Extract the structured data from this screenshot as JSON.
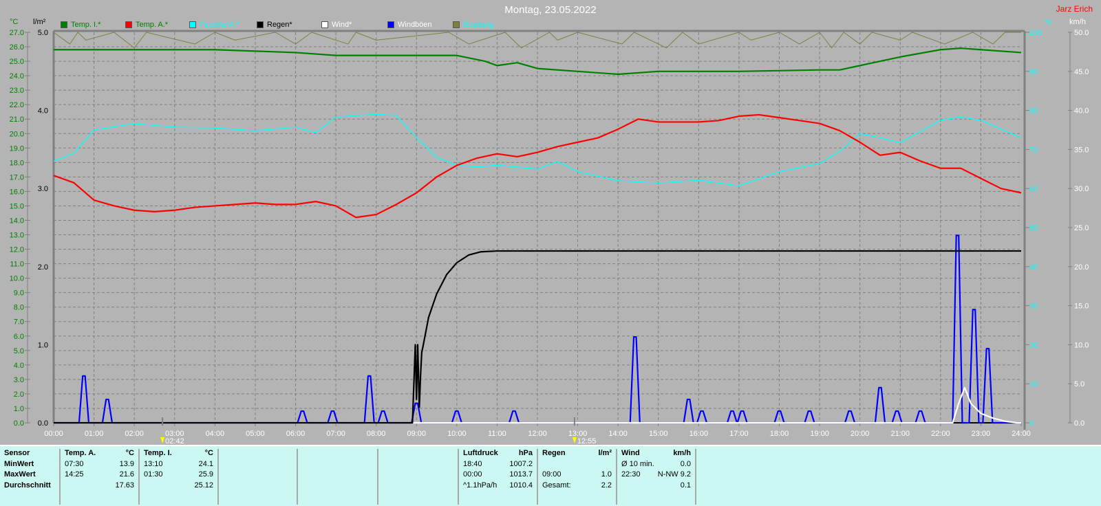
{
  "header": {
    "title": "Montag, 23.05.2022",
    "author": "Jarz Erich"
  },
  "units": {
    "left1": "°C",
    "left2": "l/m²",
    "right1": "%",
    "right2": "km/h"
  },
  "legend": [
    {
      "label": "Temp. I.*",
      "color": "#008000"
    },
    {
      "label": "Temp. A.*",
      "color": "#ff0000"
    },
    {
      "label": "Feuchte A.*",
      "color": "#00ffff"
    },
    {
      "label": "Regen*",
      "color": "#000000"
    },
    {
      "label": "Wind*",
      "color": "#ffffff"
    },
    {
      "label": "Windböen",
      "color": "#0000ff"
    },
    {
      "label": "Empfang",
      "color": "#808040"
    }
  ],
  "markers": [
    {
      "label": "02:42",
      "icon": "moon-icon",
      "t": 2.7
    },
    {
      "label": "12:55",
      "icon": "sun-icon",
      "t": 12.92
    }
  ],
  "chart_data": {
    "type": "line",
    "title": "Montag, 23.05.2022",
    "x_ticks": [
      "00:00",
      "01:00",
      "02:00",
      "03:00",
      "04:00",
      "05:00",
      "06:00",
      "07:00",
      "08:00",
      "09:00",
      "10:00",
      "11:00",
      "12:00",
      "13:00",
      "14:00",
      "15:00",
      "16:00",
      "17:00",
      "18:00",
      "19:00",
      "20:00",
      "21:00",
      "22:00",
      "23:00",
      "24:00"
    ],
    "xlim": [
      0,
      24
    ],
    "axes": {
      "temp": {
        "unit": "°C",
        "ylim": [
          0,
          27
        ],
        "step": 1
      },
      "rain": {
        "unit": "l/m²",
        "ylim": [
          0,
          5
        ],
        "step": 1
      },
      "humidity": {
        "unit": "%",
        "ylim": [
          0,
          100
        ],
        "step": 10
      },
      "wind": {
        "unit": "km/h",
        "ylim": [
          0,
          50
        ],
        "step": 5
      }
    },
    "series": [
      {
        "name": "Temp. I.*",
        "axis": "temp",
        "color": "#008000",
        "t": [
          0,
          2,
          4,
          6,
          7,
          9,
          10,
          10.7,
          11,
          11.5,
          12,
          13,
          14,
          15,
          17,
          19,
          19.5,
          20,
          21,
          22,
          22.5,
          23,
          24
        ],
        "v": [
          25.8,
          25.8,
          25.8,
          25.6,
          25.4,
          25.4,
          25.4,
          25.0,
          24.7,
          24.9,
          24.5,
          24.3,
          24.1,
          24.3,
          24.3,
          24.4,
          24.4,
          24.7,
          25.3,
          25.8,
          25.9,
          25.8,
          25.6
        ]
      },
      {
        "name": "Temp. A.*",
        "axis": "temp",
        "color": "#ff0000",
        "t": [
          0,
          0.5,
          1,
          1.5,
          2,
          2.5,
          3,
          3.5,
          4,
          4.5,
          5,
          5.5,
          6,
          6.5,
          7,
          7.5,
          8,
          8.5,
          9,
          9.5,
          10,
          10.5,
          11,
          11.5,
          12,
          12.5,
          13,
          13.5,
          14,
          14.5,
          15,
          15.5,
          16,
          16.5,
          17,
          17.5,
          18,
          18.5,
          19,
          19.5,
          20,
          20.5,
          21,
          21.5,
          22,
          22.5,
          23,
          23.5,
          24
        ],
        "v": [
          17.1,
          16.6,
          15.4,
          15.0,
          14.7,
          14.6,
          14.7,
          14.9,
          15.0,
          15.1,
          15.2,
          15.1,
          15.1,
          15.3,
          15.0,
          14.2,
          14.4,
          15.1,
          15.9,
          17.0,
          17.8,
          18.3,
          18.6,
          18.4,
          18.7,
          19.1,
          19.4,
          19.7,
          20.3,
          21.0,
          20.8,
          20.8,
          20.8,
          20.9,
          21.2,
          21.3,
          21.1,
          20.9,
          20.7,
          20.2,
          19.4,
          18.5,
          18.7,
          18.1,
          17.6,
          17.6,
          16.9,
          16.2,
          15.9
        ]
      },
      {
        "name": "Feuchte A.*",
        "axis": "humidity",
        "color": "#00ffff",
        "t": [
          0,
          0.5,
          1,
          2,
          3,
          4,
          5,
          6,
          6.5,
          7,
          8,
          8.5,
          9,
          9.5,
          10,
          10.5,
          11,
          12,
          12.5,
          13,
          14,
          15,
          16,
          17,
          18,
          19,
          19.5,
          20,
          20.5,
          21,
          22,
          22.5,
          23,
          24
        ],
        "v": [
          67,
          69,
          75,
          76.6,
          75.7,
          75.5,
          74.8,
          75.7,
          74.3,
          78.3,
          79,
          78.7,
          73,
          68,
          66,
          65.5,
          66,
          65,
          66.9,
          64.3,
          62,
          61.4,
          62.1,
          60.7,
          64.3,
          66.4,
          69.5,
          74,
          73,
          71.7,
          77.5,
          78.3,
          77.5,
          73
        ]
      },
      {
        "name": "Regen*",
        "axis": "rain",
        "color": "#000000",
        "t": [
          0,
          8.9,
          8.97,
          9.0,
          9.03,
          9.07,
          9.1,
          9.13,
          9.17,
          9.3,
          9.5,
          9.75,
          10,
          10.3,
          10.6,
          11,
          24
        ],
        "v": [
          0,
          0,
          1.0,
          0.3,
          1.0,
          0.2,
          0.6,
          0.9,
          1.0,
          1.35,
          1.65,
          1.9,
          2.05,
          2.15,
          2.19,
          2.2,
          2.2
        ]
      },
      {
        "name": "Windböen",
        "axis": "wind",
        "color": "#0000ff",
        "peaks": [
          [
            0.75,
            6.0
          ],
          [
            1.33,
            3.0
          ],
          [
            6.17,
            1.5
          ],
          [
            6.92,
            1.5
          ],
          [
            7.83,
            6.0
          ],
          [
            8.17,
            1.5
          ],
          [
            9.0,
            2.5
          ],
          [
            10.0,
            1.5
          ],
          [
            11.42,
            1.5
          ],
          [
            14.42,
            11.0
          ],
          [
            15.75,
            3.0
          ],
          [
            16.08,
            1.5
          ],
          [
            16.83,
            1.5
          ],
          [
            17.08,
            1.5
          ],
          [
            18.0,
            1.5
          ],
          [
            18.75,
            1.5
          ],
          [
            19.75,
            1.5
          ],
          [
            20.5,
            4.5
          ],
          [
            20.92,
            1.5
          ],
          [
            21.5,
            1.5
          ],
          [
            22.42,
            24.0
          ],
          [
            22.83,
            14.5
          ],
          [
            23.17,
            9.5
          ]
        ]
      },
      {
        "name": "Wind*",
        "axis": "wind",
        "color": "#ffffff",
        "t": [
          0,
          22.3,
          22.45,
          22.6,
          22.75,
          23.0,
          23.3,
          23.6,
          23.9,
          24
        ],
        "v": [
          0,
          0,
          2.5,
          4.5,
          2.5,
          1.2,
          0.6,
          0.2,
          0,
          0
        ]
      },
      {
        "name": "Empfang",
        "axis": "humidity",
        "color": "#808040",
        "t": [
          0,
          0.4,
          0.6,
          0.8,
          1.5,
          2.0,
          2.3,
          3.5,
          4.0,
          4.5,
          5.5,
          6.0,
          6.4,
          7.3,
          7.5,
          8.0,
          9.8,
          10.3,
          11.2,
          11.6,
          12.3,
          12.5,
          13.0,
          14.1,
          14.4,
          15.2,
          15.6,
          16.0,
          17.0,
          17.3,
          18.0,
          18.5,
          19.0,
          19.3,
          19.6,
          20.0,
          20.3,
          21.0,
          21.3,
          22.1,
          22.8,
          23.3,
          23.6,
          24
        ],
        "v": [
          100,
          97,
          100,
          98,
          100,
          96,
          100,
          97,
          100,
          98,
          100,
          97,
          100,
          97,
          100,
          98,
          100,
          97,
          100,
          96,
          100,
          98,
          100,
          97,
          100,
          96,
          100,
          97,
          100,
          98,
          100,
          97,
          100,
          96,
          100,
          97,
          100,
          98,
          100,
          97,
          100,
          97,
          100,
          100
        ]
      }
    ]
  },
  "table": {
    "sensor": {
      "header": "Sensor",
      "rows": [
        "MinWert",
        "MaxWert",
        "Durchschnitt"
      ]
    },
    "temp_a": {
      "header": "Temp. A.",
      "unit": "°C",
      "rows": [
        [
          "07:30",
          "13.9"
        ],
        [
          "14:25",
          "21.6"
        ],
        [
          "",
          "17.63"
        ]
      ]
    },
    "temp_i": {
      "header": "Temp. I.",
      "unit": "°C",
      "rows": [
        [
          "13:10",
          "24.1"
        ],
        [
          "01:30",
          "25.9"
        ],
        [
          "",
          "25.12"
        ]
      ]
    },
    "pressure": {
      "header": "Luftdruck",
      "unit": "hPa",
      "rows": [
        [
          "18:40",
          "1007.2"
        ],
        [
          "00:00",
          "1013.7"
        ],
        [
          "^1.1hPa/h",
          "1010.4"
        ]
      ]
    },
    "rain": {
      "header": "Regen",
      "unit": "l/m²",
      "rows": [
        [
          "",
          ""
        ],
        [
          "09:00",
          "1.0"
        ],
        [
          "Gesamt:",
          "2.2"
        ]
      ]
    },
    "wind": {
      "header": "Wind",
      "unit": "km/h",
      "rows": [
        [
          "Ø 10 min.",
          "0.0"
        ],
        [
          "22:30",
          "N-NW 9.2"
        ],
        [
          "",
          "0.1"
        ]
      ]
    }
  }
}
